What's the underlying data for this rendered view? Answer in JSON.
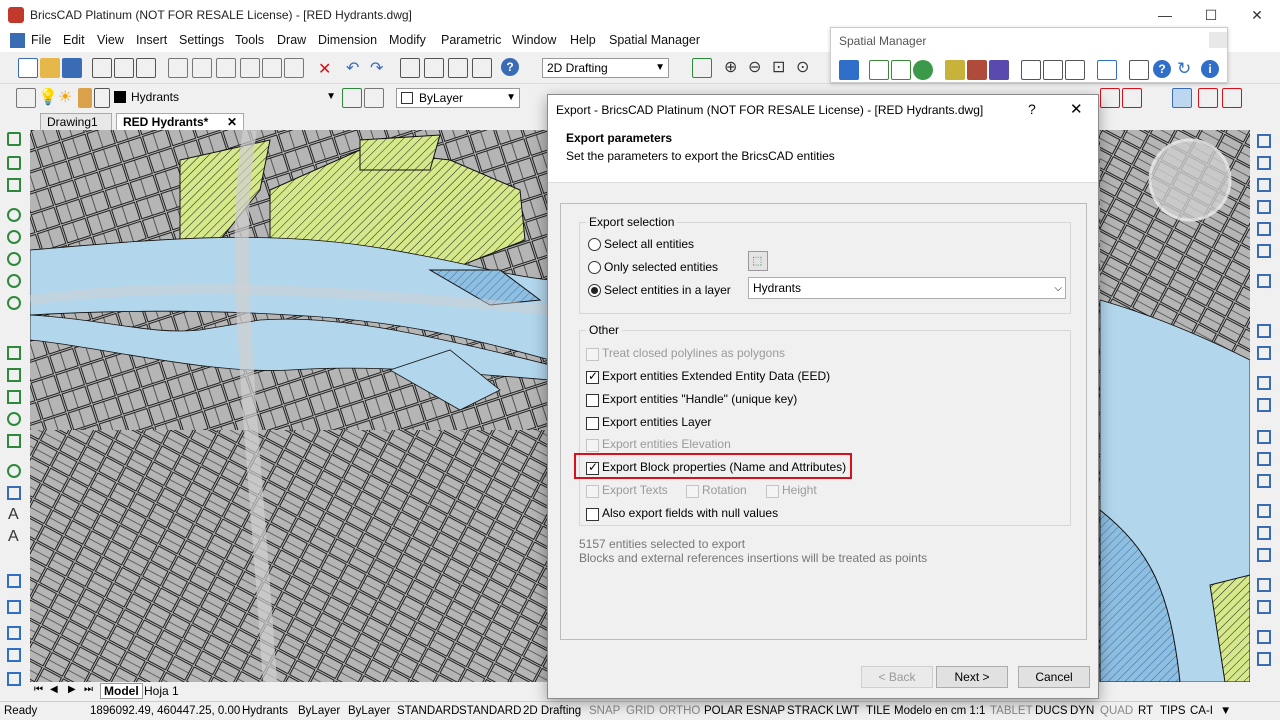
{
  "app": {
    "title": "BricsCAD Platinum (NOT FOR RESALE License) - [RED Hydrants.dwg]"
  },
  "menu": [
    "File",
    "Edit",
    "View",
    "Insert",
    "Settings",
    "Tools",
    "Draw",
    "Dimension",
    "Modify",
    "Parametric",
    "Window",
    "Help",
    "Spatial Manager"
  ],
  "toolbar": {
    "workspace": "2D Drafting",
    "layer": "Hydrants",
    "color": "ByLayer"
  },
  "spatial_manager": {
    "title": "Spatial Manager"
  },
  "doc_tabs": [
    {
      "label": "Drawing1"
    },
    {
      "label": "RED Hydrants*"
    }
  ],
  "layout_tabs": {
    "model": "Model",
    "sheet": "Hoja 1"
  },
  "status": {
    "ready": "Ready",
    "coords": "1896092.49, 460447.25, 0.00",
    "layer": "Hydrants",
    "color": "ByLayer",
    "linetype": "ByLayer",
    "textstyle": "STANDARD",
    "dimstyle": "STANDARD",
    "workspace": "2D Drafting",
    "toggles": [
      "SNAP",
      "GRID",
      "ORTHO",
      "POLAR",
      "ESNAP",
      "STRACK",
      "LWT",
      "TILE",
      "Modelo en cm 1:1",
      "TABLET",
      "DUCS",
      "DYN",
      "QUAD",
      "RT",
      "TIPS",
      "CA-I"
    ]
  },
  "dialog": {
    "title": "Export - BricsCAD Platinum (NOT FOR RESALE License) - [RED Hydrants.dwg]",
    "help": "?",
    "close": "✕",
    "header_title": "Export parameters",
    "header_subtitle": "Set the parameters to export the BricsCAD entities",
    "selection_group": "Export selection",
    "radio_all": "Select all entities",
    "radio_selected": "Only selected entities",
    "radio_layer": "Select entities in a layer",
    "layer_value": "Hydrants",
    "other_group": "Other",
    "opt_polygons": "Treat closed polylines as polygons",
    "opt_eed": "Export entities Extended Entity Data (EED)",
    "opt_handle": "Export entities \"Handle\" (unique key)",
    "opt_layer": "Export entities Layer",
    "opt_elevation": "Export entities Elevation",
    "opt_block": "Export Block properties (Name and Attributes)",
    "opt_texts": "Export Texts",
    "opt_rotation": "Rotation",
    "opt_height": "Height",
    "opt_null": "Also export fields with null values",
    "info1": "5157 entities selected to export",
    "info2": "Blocks and external references insertions will be treated as points",
    "btn_back": "< Back",
    "btn_next": "Next >",
    "btn_cancel": "Cancel"
  },
  "colors": {
    "highlight": "#d9101a",
    "water": "#b2d6ec",
    "park": "#d5e88a"
  }
}
